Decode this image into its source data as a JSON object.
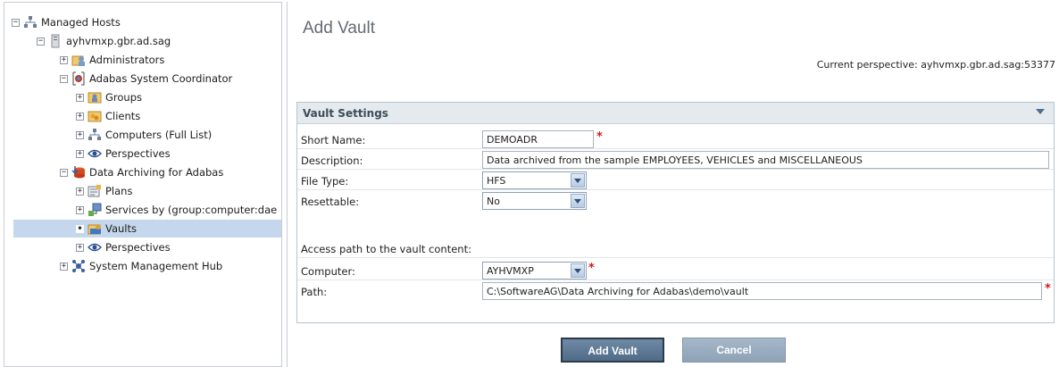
{
  "tree": {
    "items": [
      {
        "label": "Managed Hosts",
        "toggle": "−",
        "icon": "managed-hosts-icon"
      },
      {
        "label": "ayhvmxp.gbr.ad.sag",
        "toggle": "−",
        "icon": "server-icon"
      },
      {
        "label": "Administrators",
        "toggle": "+",
        "icon": "administrators-icon"
      },
      {
        "label": "Adabas System Coordinator",
        "toggle": "−",
        "icon": "adabas-coordinator-icon"
      },
      {
        "label": "Groups",
        "toggle": "+",
        "icon": "groups-icon"
      },
      {
        "label": "Clients",
        "toggle": "+",
        "icon": "clients-icon"
      },
      {
        "label": "Computers (Full List)",
        "toggle": "+",
        "icon": "computers-icon"
      },
      {
        "label": "Perspectives",
        "toggle": "+",
        "icon": "eye-icon"
      },
      {
        "label": "Data Archiving for Adabas",
        "toggle": "−",
        "icon": "data-archiving-icon"
      },
      {
        "label": "Plans",
        "toggle": "+",
        "icon": "plans-icon"
      },
      {
        "label": "Services by (group:computer:dae",
        "toggle": "+",
        "icon": "services-icon"
      },
      {
        "label": "Vaults",
        "toggle": "•",
        "icon": "vault-icon"
      },
      {
        "label": "Perspectives",
        "toggle": "+",
        "icon": "eye-icon"
      },
      {
        "label": "System Management Hub",
        "toggle": "+",
        "icon": "smh-icon"
      }
    ]
  },
  "main": {
    "title": "Add Vault",
    "perspective": "Current perspective: ayhvmxp.gbr.ad.sag:53377",
    "panel_title": "Vault Settings",
    "fields": {
      "short_name_label": "Short Name:",
      "short_name_value": "DEMOADR",
      "description_label": "Description:",
      "description_value": "Data archived from the sample EMPLOYEES, VEHICLES and MISCELLANEOUS",
      "file_type_label": "File Type:",
      "file_type_value": "HFS",
      "resettable_label": "Resettable:",
      "resettable_value": "No",
      "access_path_heading": "Access path to the vault content:",
      "computer_label": "Computer:",
      "computer_value": "AYHVMXP",
      "path_label": "Path:",
      "path_value": "C:\\SoftwareAG\\Data Archiving for Adabas\\demo\\vault",
      "required_marker": "*"
    },
    "buttons": {
      "add": "Add Vault",
      "cancel": "Cancel"
    }
  },
  "colors": {
    "selection": "#c5d7ec",
    "panel_header": "#e4eaee",
    "primary_button": "#5f7a96",
    "required": "#d21a1a"
  }
}
